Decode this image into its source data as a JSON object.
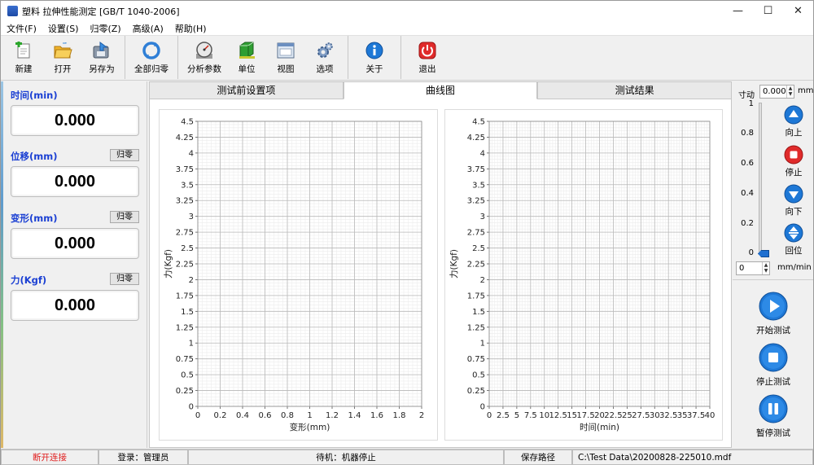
{
  "window": {
    "title": "塑料 拉伸性能测定 [GB/T 1040-2006]",
    "controls": {
      "minimize": "—",
      "maximize": "☐",
      "close": "✕"
    }
  },
  "menu": [
    "文件(F)",
    "设置(S)",
    "归零(Z)",
    "高级(A)",
    "帮助(H)"
  ],
  "toolbar": {
    "new": "新建",
    "open": "打开",
    "save_as": "另存为",
    "zero_all": "全部归零",
    "params": "分析参数",
    "unit": "单位",
    "view": "视图",
    "options": "选项",
    "about": "关于",
    "exit": "退出"
  },
  "meters": {
    "time": {
      "label": "时间(min)",
      "value": "0.000"
    },
    "disp": {
      "label": "位移(mm)",
      "value": "0.000",
      "zero": "归零"
    },
    "deform": {
      "label": "变形(mm)",
      "value": "0.000",
      "zero": "归零"
    },
    "force": {
      "label": "力(Kgf)",
      "value": "0.000",
      "zero": "归零"
    }
  },
  "tabs": [
    "测试前设置项",
    "曲线图",
    "测试结果"
  ],
  "active_tab": 1,
  "right": {
    "jog_label": "寸动",
    "jog_value": "0.000",
    "jog_unit": "mm",
    "slider_ticks": [
      "1",
      "0.8",
      "0.6",
      "0.4",
      "0.2",
      "0"
    ],
    "slider_level": 0,
    "up": "向上",
    "stop": "停止",
    "down": "向下",
    "home": "回位",
    "speed_value": "0",
    "speed_unit": "mm/min",
    "start_test": "开始测试",
    "stop_test": "停止测试",
    "pause_test": "暂停测试"
  },
  "status": {
    "conn": "断开连接",
    "login": "登录：管理员",
    "machine": "待机：机器停止",
    "save_path_label": "保存路径",
    "save_path": "C:\\Test Data\\20200828-225010.mdf"
  },
  "colors": {
    "accent_blue": "#1a3fd3",
    "disconnect_red": "#e02020",
    "btn_blue": "#1e78d6",
    "btn_red": "#e02b2b"
  },
  "chart_data": [
    {
      "type": "line",
      "xlabel": "变形(mm)",
      "ylabel": "力(Kgf)",
      "xlim": [
        0,
        2
      ],
      "ylim": [
        0,
        4.5
      ],
      "x_ticks": [
        "0",
        "0.2",
        "0.4",
        "0.6",
        "0.8",
        "1",
        "1.2",
        "1.4",
        "1.6",
        "1.8",
        "2"
      ],
      "y_ticks": [
        "0",
        "0.25",
        "0.5",
        "0.75",
        "1",
        "1.25",
        "1.5",
        "1.75",
        "2",
        "2.25",
        "2.5",
        "2.75",
        "3",
        "3.25",
        "3.5",
        "3.75",
        "4",
        "4.25",
        "4.5"
      ],
      "grid": true,
      "series": []
    },
    {
      "type": "line",
      "xlabel": "时间(min)",
      "ylabel": "力(Kgf)",
      "xlim": [
        0,
        40
      ],
      "ylim": [
        0,
        4.5
      ],
      "x_ticks": [
        "0",
        "2.5",
        "5",
        "7.5",
        "10",
        "12.5",
        "15",
        "17.5",
        "20",
        "22.5",
        "25",
        "27.5",
        "30",
        "32.5",
        "35",
        "37.5",
        "40"
      ],
      "y_ticks": [
        "0",
        "0.25",
        "0.5",
        "0.75",
        "1",
        "1.25",
        "1.5",
        "1.75",
        "2",
        "2.25",
        "2.5",
        "2.75",
        "3",
        "3.25",
        "3.5",
        "3.75",
        "4",
        "4.25",
        "4.5"
      ],
      "grid": true,
      "series": []
    }
  ]
}
